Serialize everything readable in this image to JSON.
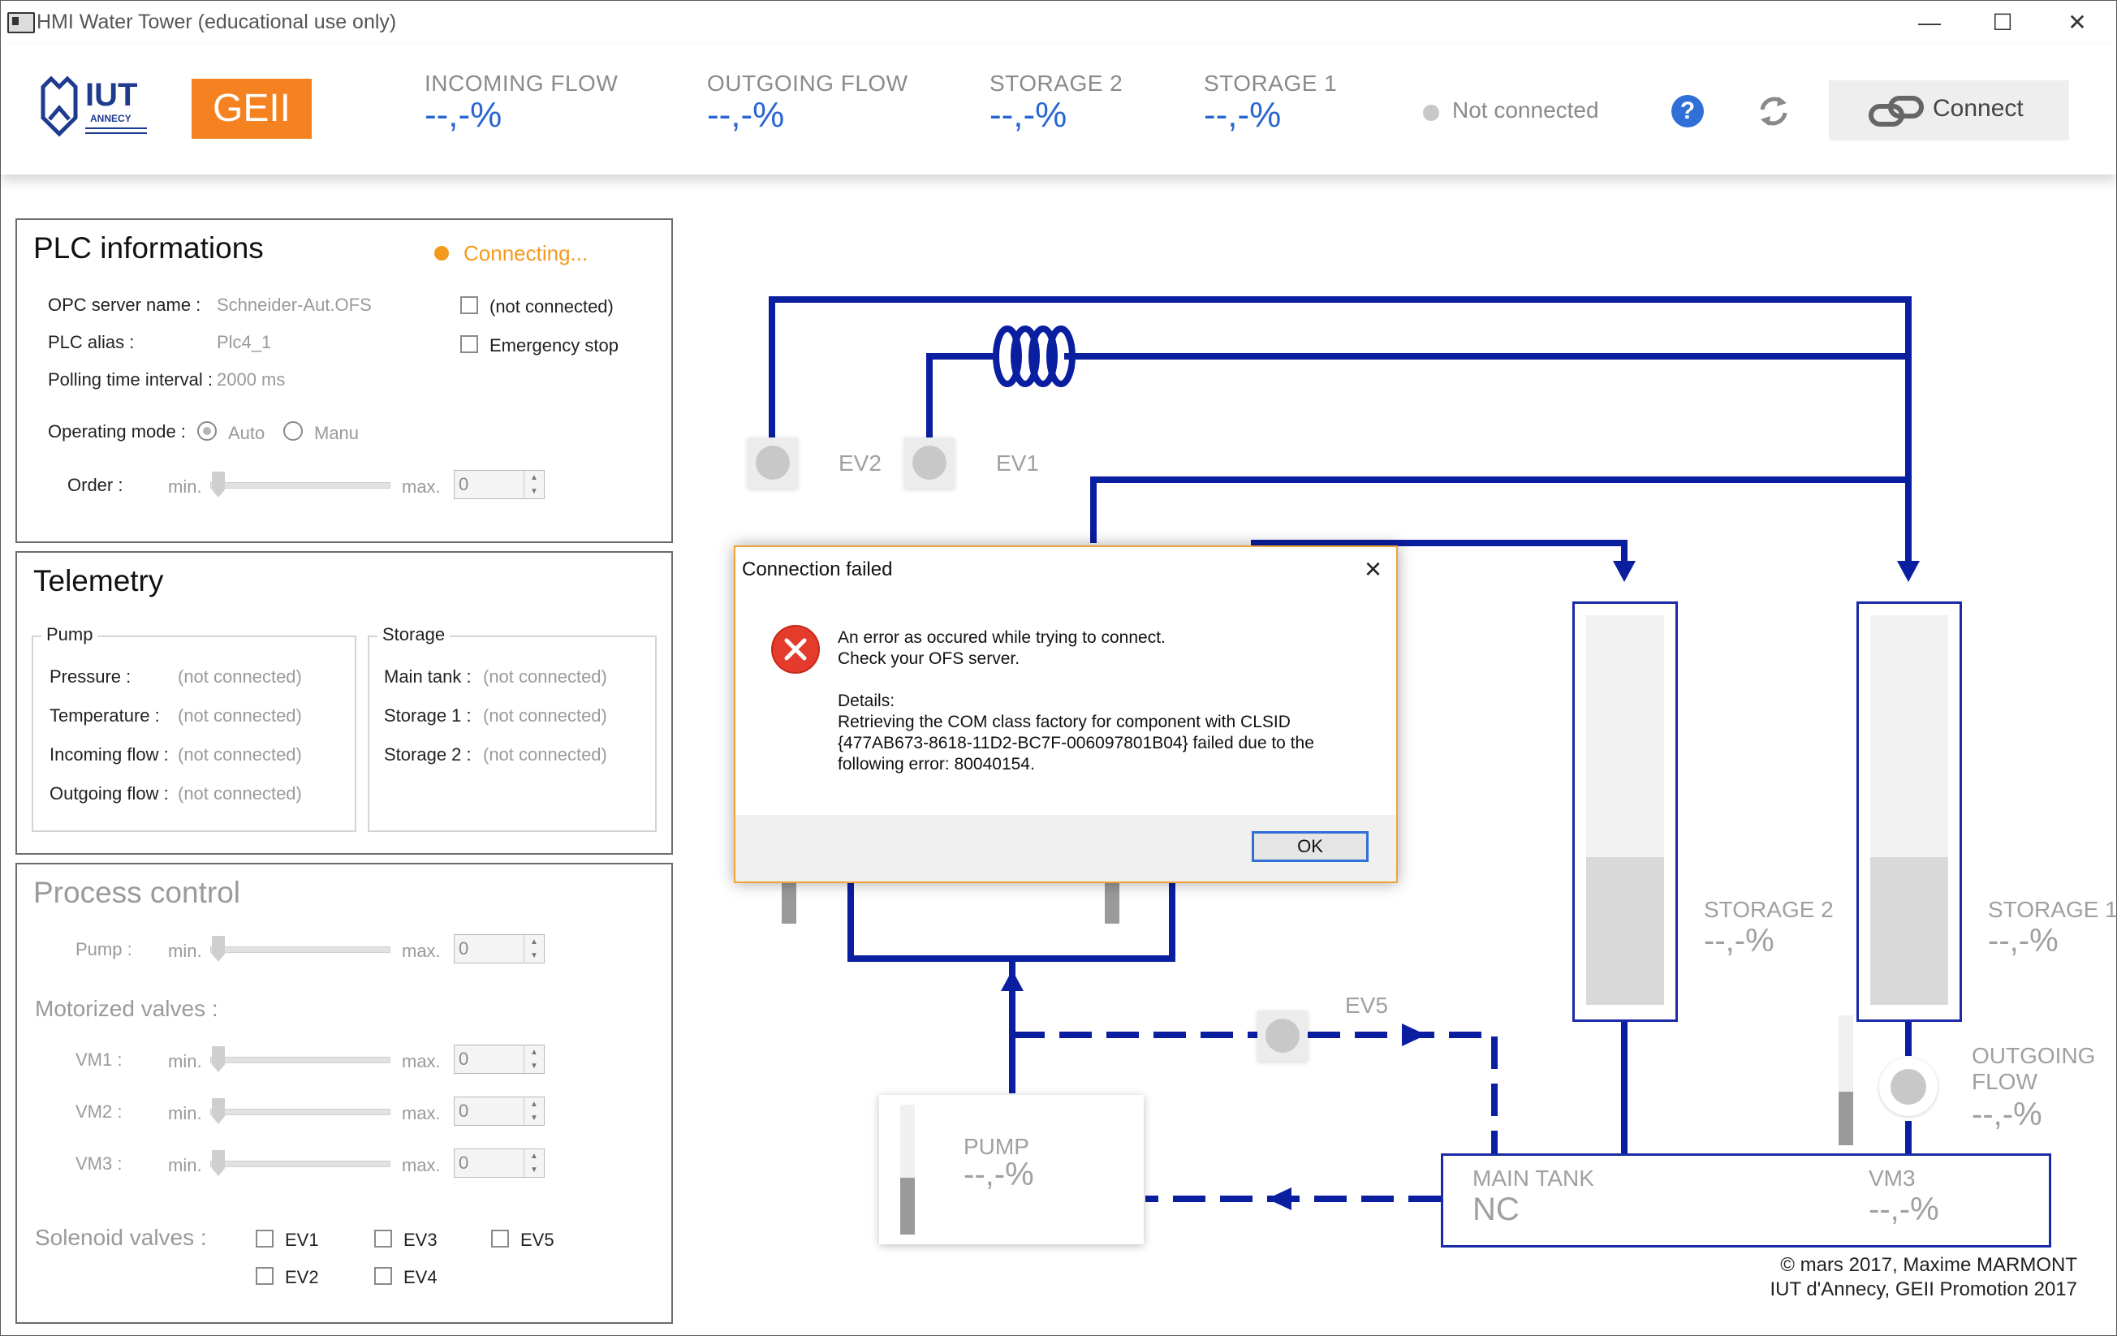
{
  "window": {
    "title": "HMI Water Tower (educational use only)",
    "minimize": "—",
    "maximize": "☐",
    "close": "✕"
  },
  "header": {
    "logo_iut": "IUT",
    "logo_iut_sub": "ANNECY",
    "logo_geii": "GEII",
    "kpis": [
      {
        "label": "INCOMING FLOW",
        "value": "--,-%"
      },
      {
        "label": "OUTGOING FLOW",
        "value": "--,-%"
      },
      {
        "label": "STORAGE 2",
        "value": "--,-%"
      },
      {
        "label": "STORAGE 1",
        "value": "--,-%"
      }
    ],
    "status_text": "Not connected",
    "help_label": "?",
    "connect_label": "Connect"
  },
  "plc": {
    "title": "PLC informations",
    "status": "Connecting...",
    "opc_label": "OPC server name :",
    "opc_value": "Schneider-Aut.OFS",
    "alias_label": "PLC alias :",
    "alias_value": "Plc4_1",
    "polling_label": "Polling time interval :",
    "polling_value": "2000 ms",
    "not_connected_cb": "(not connected)",
    "emergency_cb": "Emergency stop",
    "mode_label": "Operating mode :",
    "mode_auto": "Auto",
    "mode_manu": "Manu",
    "order_label": "Order :",
    "min": "min.",
    "max": "max.",
    "order_value": "0"
  },
  "telemetry": {
    "title": "Telemetry",
    "pump_group": "Pump",
    "storage_group": "Storage",
    "pump_rows": [
      {
        "label": "Pressure :",
        "value": "(not connected)"
      },
      {
        "label": "Temperature :",
        "value": "(not connected)"
      },
      {
        "label": "Incoming flow :",
        "value": "(not connected)"
      },
      {
        "label": "Outgoing flow :",
        "value": "(not connected)"
      }
    ],
    "storage_rows": [
      {
        "label": "Main tank :",
        "value": "(not connected)"
      },
      {
        "label": "Storage 1 :",
        "value": "(not connected)"
      },
      {
        "label": "Storage 2 :",
        "value": "(not connected)"
      }
    ]
  },
  "process": {
    "title": "Process control",
    "pump_label": "Pump :",
    "motorized_title": "Motorized valves :",
    "vm1": "VM1 :",
    "vm2": "VM2 :",
    "vm3": "VM3 :",
    "min": "min.",
    "max": "max.",
    "value": "0",
    "solenoid_title": "Solenoid valves :",
    "ev1": "EV1",
    "ev2": "EV2",
    "ev3": "EV3",
    "ev4": "EV4",
    "ev5": "EV5"
  },
  "diagram": {
    "ev2": "EV2",
    "ev1": "EV1",
    "ev5": "EV5",
    "storage2_label": "STORAGE 2",
    "storage2_value": "--,-%",
    "storage1_label": "STORAGE 1",
    "storage1_value": "--,-%",
    "outgoing_label1": "OUTGOING",
    "outgoing_label2": "FLOW",
    "outgoing_value": "--,-%",
    "pump_label": "PUMP",
    "pump_value": "--,-%",
    "main_tank_label": "MAIN TANK",
    "main_tank_value": "NC",
    "vm3_label": "VM3",
    "vm3_value": "--,-%",
    "copyright1": "© mars 2017, Maxime MARMONT",
    "copyright2": "IUT d'Annecy, GEII Promotion 2017",
    "colors": {
      "pipe": "#0a1ea0",
      "accent": "#2a66d1",
      "warning": "#f39a1e",
      "error": "#e53b2c"
    }
  },
  "dialog": {
    "title": "Connection failed",
    "line1": "An error as occured while trying to connect.",
    "line2": "Check your OFS server.",
    "details": "Details:",
    "d1": "Retrieving the COM class factory for component with CLSID",
    "d2": "{477AB673-8618-11D2-BC7F-006097801B04} failed due to the",
    "d3": "following error: 80040154.",
    "ok": "OK"
  }
}
